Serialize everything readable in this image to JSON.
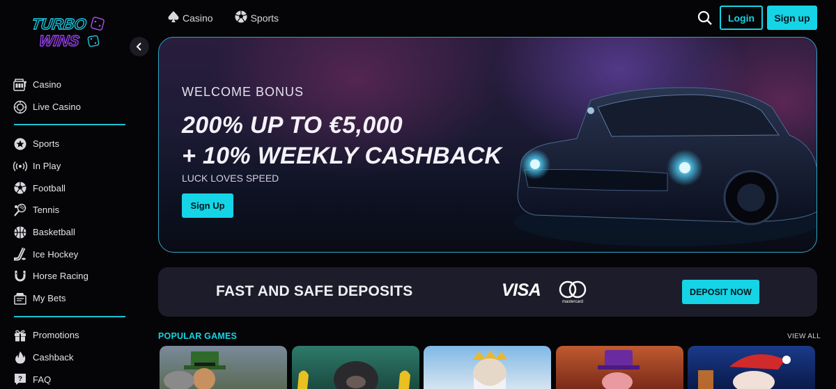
{
  "brand": {
    "logo_line1": "TURBO",
    "logo_line2": "WINS"
  },
  "sidebar": {
    "group1": [
      {
        "label": "Casino",
        "icon": "slot-machine-icon"
      },
      {
        "label": "Live Casino",
        "icon": "live-chip-icon"
      }
    ],
    "group2": [
      {
        "label": "Sports",
        "icon": "star-badge-icon"
      },
      {
        "label": "In Play",
        "icon": "broadcast-icon"
      },
      {
        "label": "Football",
        "icon": "football-icon"
      },
      {
        "label": "Tennis",
        "icon": "tennis-icon"
      },
      {
        "label": "Basketball",
        "icon": "basketball-icon"
      },
      {
        "label": "Ice Hockey",
        "icon": "hockey-stick-icon"
      },
      {
        "label": "Horse Racing",
        "icon": "horseshoe-icon"
      },
      {
        "label": "My Bets",
        "icon": "bet-slip-icon"
      }
    ],
    "group3": [
      {
        "label": "Promotions",
        "icon": "gift-icon"
      },
      {
        "label": "Cashback",
        "icon": "flame-icon"
      },
      {
        "label": "FAQ",
        "icon": "question-icon"
      }
    ]
  },
  "topnav": {
    "casino": "Casino",
    "sports": "Sports",
    "login": "Login",
    "signup": "Sign up"
  },
  "banner": {
    "eyebrow": "WELCOME BONUS",
    "headline1": "200% UP TO €5,000",
    "headline2": "+ 10% WEEKLY CASHBACK",
    "tagline": "LUCK LOVES SPEED",
    "cta": "Sign Up"
  },
  "deposits": {
    "title": "FAST AND SAFE DEPOSITS",
    "visa": "VISA",
    "mastercard": "mastercard",
    "cta": "DEPOSIT NOW"
  },
  "popular": {
    "title": "POPULAR GAMES",
    "view_all": "VIEW ALL",
    "games": [
      {
        "name": "leprechaun-game"
      },
      {
        "name": "gorilla-game"
      },
      {
        "name": "zeus-game"
      },
      {
        "name": "purple-hat-game"
      },
      {
        "name": "santa-game"
      }
    ]
  },
  "colors": {
    "accent": "#14d4e6",
    "background": "#050507",
    "panel": "#1d1c2a"
  }
}
